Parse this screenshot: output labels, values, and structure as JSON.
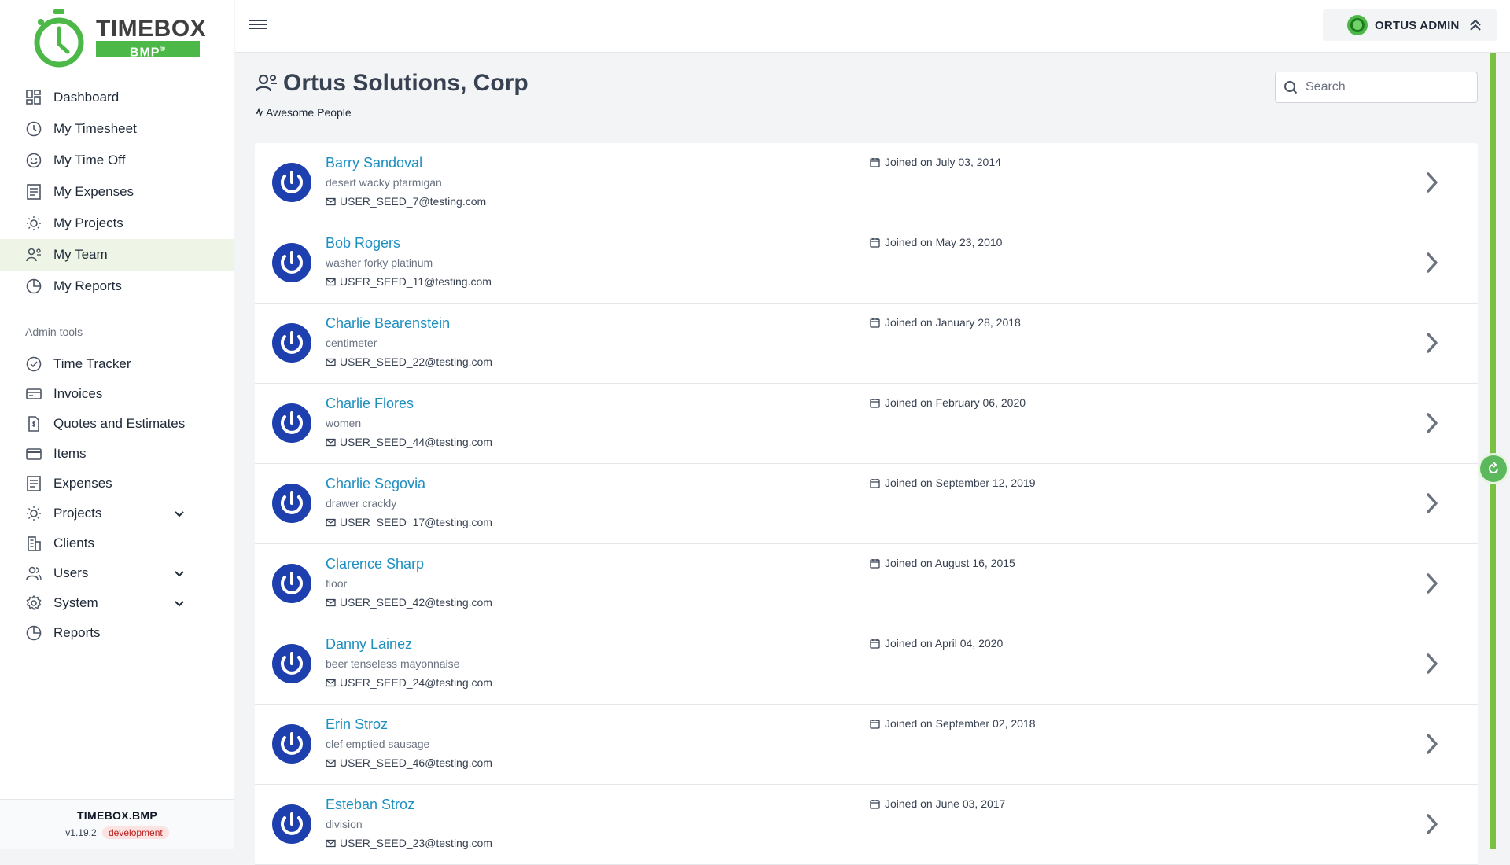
{
  "brand": {
    "word": "TIMEBOX",
    "sub": "BMP",
    "accent": "#4cb848"
  },
  "nav": {
    "items": [
      {
        "label": "Dashboard",
        "icon": "dashboard-icon"
      },
      {
        "label": "My Timesheet",
        "icon": "clock-icon"
      },
      {
        "label": "My Time Off",
        "icon": "smile-icon"
      },
      {
        "label": "My Expenses",
        "icon": "receipt-icon"
      },
      {
        "label": "My Projects",
        "icon": "lightbulb-icon"
      },
      {
        "label": "My Team",
        "icon": "team-icon",
        "active": true
      },
      {
        "label": "My Reports",
        "icon": "pie-chart-icon"
      }
    ],
    "admin_label": "Admin tools",
    "admin_items": [
      {
        "label": "Time Tracker",
        "icon": "check-circle-icon"
      },
      {
        "label": "Invoices",
        "icon": "invoice-icon"
      },
      {
        "label": "Quotes and Estimates",
        "icon": "document-dollar-icon"
      },
      {
        "label": "Items",
        "icon": "card-icon"
      },
      {
        "label": "Expenses",
        "icon": "receipt-icon"
      },
      {
        "label": "Projects",
        "icon": "lightbulb-icon",
        "expandable": true
      },
      {
        "label": "Clients",
        "icon": "building-icon"
      },
      {
        "label": "Users",
        "icon": "users-icon",
        "expandable": true
      },
      {
        "label": "System",
        "icon": "gear-icon",
        "expandable": true
      },
      {
        "label": "Reports",
        "icon": "pie-chart-icon"
      }
    ]
  },
  "footer": {
    "title": "TIMEBOX.BMP",
    "version": "v1.19.2",
    "env": "development"
  },
  "topbar": {
    "user": "ORTUS ADMIN"
  },
  "page": {
    "title": "Ortus Solutions, Corp",
    "subtitle": "Awesome People",
    "search_placeholder": "Search"
  },
  "members": [
    {
      "name": "Barry Sandoval",
      "desc": "desert wacky ptarmigan",
      "email": "USER_SEED_7@testing.com",
      "joined": "Joined on July 03, 2014"
    },
    {
      "name": "Bob Rogers",
      "desc": "washer forky platinum",
      "email": "USER_SEED_11@testing.com",
      "joined": "Joined on May 23, 2010"
    },
    {
      "name": "Charlie Bearenstein",
      "desc": "centimeter",
      "email": "USER_SEED_22@testing.com",
      "joined": "Joined on January 28, 2018"
    },
    {
      "name": "Charlie Flores",
      "desc": "women",
      "email": "USER_SEED_44@testing.com",
      "joined": "Joined on February 06, 2020"
    },
    {
      "name": "Charlie Segovia",
      "desc": "drawer crackly",
      "email": "USER_SEED_17@testing.com",
      "joined": "Joined on September 12, 2019"
    },
    {
      "name": "Clarence Sharp",
      "desc": "floor",
      "email": "USER_SEED_42@testing.com",
      "joined": "Joined on August 16, 2015"
    },
    {
      "name": "Danny Lainez",
      "desc": "beer tenseless mayonnaise",
      "email": "USER_SEED_24@testing.com",
      "joined": "Joined on April 04, 2020"
    },
    {
      "name": "Erin Stroz",
      "desc": "clef emptied sausage",
      "email": "USER_SEED_46@testing.com",
      "joined": "Joined on September 02, 2018"
    },
    {
      "name": "Esteban Stroz",
      "desc": "division",
      "email": "USER_SEED_23@testing.com",
      "joined": "Joined on June 03, 2017"
    }
  ]
}
